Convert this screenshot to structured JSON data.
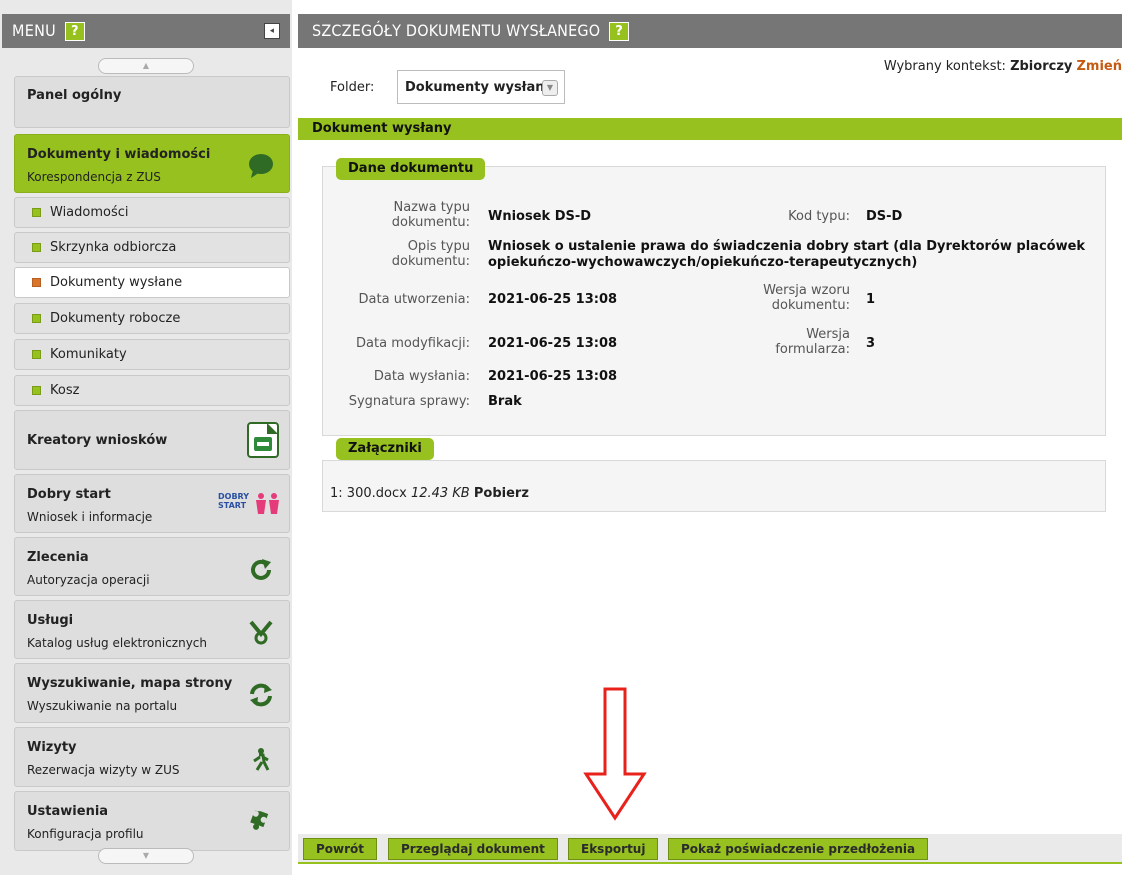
{
  "sidebar": {
    "title": "MENU",
    "help": "?",
    "collapse": "◂",
    "scroll_up": "▲",
    "scroll_down": "▼",
    "top_item": "Panel ogólny",
    "items": [
      {
        "title": "Dokumenty i wiadomości",
        "subtitle": "Korespondencja z ZUS",
        "icon": "speech-bubble-icon"
      },
      {
        "title": "Kreatory wniosków",
        "subtitle": "",
        "icon": "document-form-icon"
      },
      {
        "title": "Dobry start",
        "subtitle": "Wniosek i informacje",
        "icon": "dobry-start-logo",
        "logo_text": "DOBRY START"
      },
      {
        "title": "Zlecenia",
        "subtitle": "Autoryzacja operacji",
        "icon": "refresh-icon"
      },
      {
        "title": "Usługi",
        "subtitle": "Katalog usług elektronicznych",
        "icon": "tools-icon"
      },
      {
        "title": "Wyszukiwanie, mapa strony",
        "subtitle": "Wyszukiwanie na portalu",
        "icon": "sync-icon"
      },
      {
        "title": "Wizyty",
        "subtitle": "Rezerwacja wizyty w ZUS",
        "icon": "walking-person-icon"
      },
      {
        "title": "Ustawienia",
        "subtitle": "Konfiguracja profilu",
        "icon": "puzzle-icon"
      }
    ],
    "subitems": [
      "Wiadomości",
      "Skrzynka odbiorcza",
      "Dokumenty wysłane",
      "Dokumenty robocze",
      "Komunikaty",
      "Kosz"
    ]
  },
  "main": {
    "title": "SZCZEGÓŁY DOKUMENTU WYSŁANEGO",
    "help": "?",
    "folder_label": "Folder:",
    "folder_value": "Dokumenty wysłane",
    "context_label": "Wybrany kontekst:",
    "context_value": "Zbiorczy",
    "context_change": "Zmień",
    "doc_bar": "Dokument wysłany",
    "section_title": "Dane dokumentu",
    "fields": {
      "type_name_label": "Nazwa typu dokumentu:",
      "type_name_value": "Wniosek DS-D",
      "type_code_label": "Kod typu:",
      "type_code_value": "DS-D",
      "desc_label": "Opis typu dokumentu:",
      "desc_value": "Wniosek o ustalenie prawa do świadczenia dobry start (dla Dyrektorów placówek opiekuńczo-wychowawczych/opiekuńczo-terapeutycznych)",
      "created_label": "Data utworzenia:",
      "created_value": "2021-06-25 13:08",
      "template_version_label": "Wersja wzoru dokumentu:",
      "template_version_value": "1",
      "modified_label": "Data modyfikacji:",
      "modified_value": "2021-06-25 13:08",
      "form_version_label": "Wersja formularza:",
      "form_version_value": "3",
      "sent_label": "Data wysłania:",
      "sent_value": "2021-06-25 13:08",
      "case_label": "Sygnatura sprawy:",
      "case_value": "Brak"
    },
    "attachments_title": "Załączniki",
    "attachment": {
      "index": "1:",
      "name": "300.docx",
      "size": "12.43 KB",
      "download": "Pobierz"
    },
    "buttons": [
      "Powrót",
      "Przeglądaj dokument",
      "Eksportuj",
      "Pokaż poświadczenie przedłożenia"
    ],
    "annotation_color": "#e8221b",
    "accent_color": "#96c11f"
  }
}
